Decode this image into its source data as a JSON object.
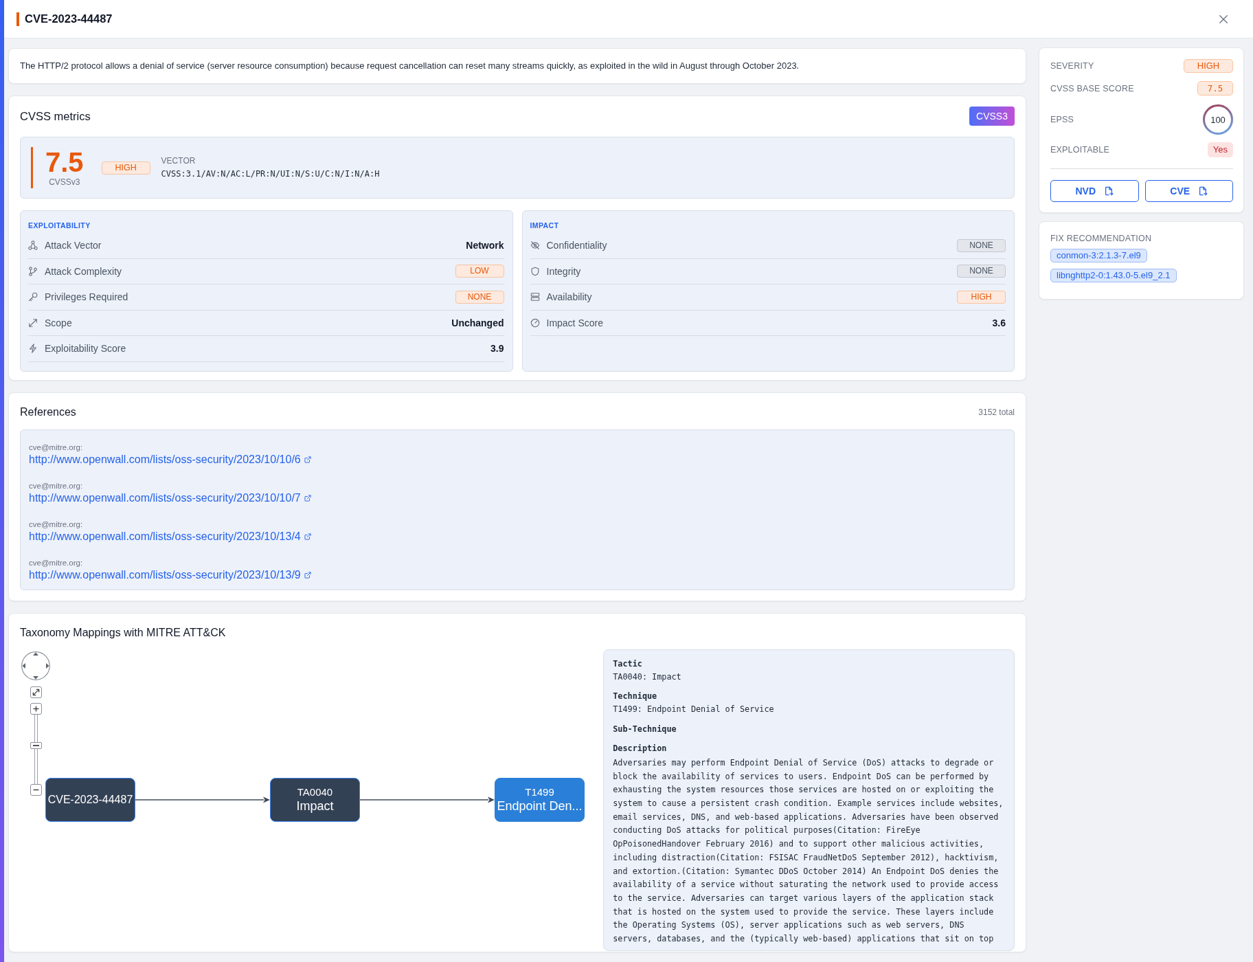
{
  "header": {
    "title": "CVE-2023-44487"
  },
  "summary": "The HTTP/2 protocol allows a denial of service (server resource consumption) because request cancellation can reset many streams quickly, as exploited in the wild in August through October 2023.",
  "cvss": {
    "title": "CVSS metrics",
    "version": "CVSS3",
    "score": "7.5",
    "score_caption": "CVSSv3",
    "severity": "HIGH",
    "vector_label": "VECTOR",
    "vector": "CVSS:3.1/AV:N/AC:L/PR:N/UI:N/S:U/C:N/I:N/A:H",
    "groups": [
      {
        "title": "EXPLOITABILITY",
        "metrics": [
          {
            "label": "Attack Vector",
            "value": "Network",
            "kind": "text"
          },
          {
            "label": "Attack Complexity",
            "value": "LOW",
            "kind": "alert"
          },
          {
            "label": "Privileges Required",
            "value": "NONE",
            "kind": "alert"
          },
          {
            "label": "Scope",
            "value": "Unchanged",
            "kind": "text"
          },
          {
            "label": "Exploitability Score",
            "value": "3.9",
            "kind": "text"
          }
        ]
      },
      {
        "title": "IMPACT",
        "metrics": [
          {
            "label": "Confidentiality",
            "value": "NONE",
            "kind": "muted"
          },
          {
            "label": "Integrity",
            "value": "NONE",
            "kind": "muted"
          },
          {
            "label": "Availability",
            "value": "HIGH",
            "kind": "alert"
          },
          {
            "label": "Impact Score",
            "value": "3.6",
            "kind": "text"
          }
        ]
      }
    ]
  },
  "references": {
    "title": "References",
    "total": "3152 total",
    "items": [
      {
        "source": "cve@mitre.org:",
        "url": "http://www.openwall.com/lists/oss-security/2023/10/10/6"
      },
      {
        "source": "cve@mitre.org:",
        "url": "http://www.openwall.com/lists/oss-security/2023/10/10/7"
      },
      {
        "source": "cve@mitre.org:",
        "url": "http://www.openwall.com/lists/oss-security/2023/10/13/4"
      },
      {
        "source": "cve@mitre.org:",
        "url": "http://www.openwall.com/lists/oss-security/2023/10/13/9"
      }
    ]
  },
  "taxonomy": {
    "title": "Taxonomy Mappings with MITRE ATT&CK",
    "graph": {
      "zoom": {
        "level": 0.55
      },
      "nodes": [
        {
          "title": "CVE-2023-44487",
          "selected": false
        },
        {
          "title": "TA0040",
          "subtitle": "Impact",
          "selected": false
        },
        {
          "title": "T1499",
          "subtitle": "Endpoint Den...",
          "selected": true
        }
      ]
    },
    "details": [
      {
        "heading": "Tactic",
        "value": "TA0040: Impact"
      },
      {
        "heading": "Technique",
        "value": "T1499: Endpoint Denial of Service"
      },
      {
        "heading": "Sub-Technique"
      },
      {
        "heading": "Description",
        "value": "Adversaries may perform Endpoint Denial of Service (DoS) attacks to degrade or block the availability of services to users. Endpoint DoS can be performed by exhausting the system resources those services are hosted on or exploiting the system to cause a persistent crash condition. Example services include websites, email services, DNS, and web-based applications. Adversaries have been observed conducting DoS attacks for political purposes(Citation: FireEye OpPoisonedHandover February 2016) and to support other malicious activities, including distraction(Citation: FSISAC FraudNetDoS September 2012), hacktivism, and extortion.(Citation: Symantec DDoS October 2014) An Endpoint DoS denies the availability of a service without saturating the network used to provide access to the service. Adversaries can target various layers of the application stack that is hosted on the system used to provide the service. These layers include the Operating Systems (OS), server applications such as web servers, DNS servers, databases, and the (typically web-based) applications that sit on top"
      }
    ]
  },
  "sidebar": {
    "facts": [
      {
        "label": "SEVERITY",
        "value": "HIGH",
        "kind": "badge"
      },
      {
        "label": "CVSS BASE SCORE",
        "value": "7.5",
        "kind": "score"
      },
      {
        "label": "EPSS",
        "value": "100",
        "kind": "ring",
        "level": 1
      },
      {
        "label": "EXPLOITABLE",
        "value": "Yes",
        "kind": "flag"
      }
    ],
    "links": [
      {
        "label": "NVD"
      },
      {
        "label": "CVE"
      }
    ]
  },
  "fix": {
    "title": "FIX RECOMMENDATION",
    "packages": [
      "conmon-3:2.1.3-7.el9",
      "libnghttp2-0:1.43.0-5.el9_2.1"
    ]
  }
}
